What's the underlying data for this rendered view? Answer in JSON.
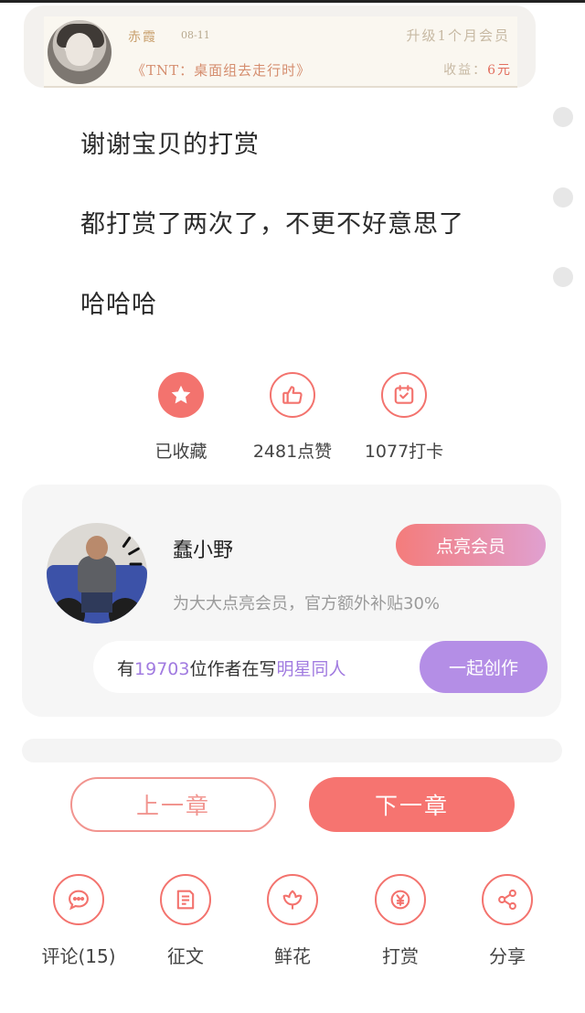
{
  "header": {
    "name": "赤霞",
    "date": "08-11",
    "rank": "升级1个月会员",
    "book": "《TNT：桌面组去走行时》",
    "income_label": "收益：",
    "income_value": "6元"
  },
  "chapter": {
    "lines": [
      "谢谢宝贝的打赏",
      "都打赏了两次了，不更不好意思了",
      "哈哈哈"
    ]
  },
  "actions": [
    {
      "label": "已收藏",
      "icon": "star-icon"
    },
    {
      "label": "2481点赞",
      "icon": "thumbs-up-icon"
    },
    {
      "label": "1077打卡",
      "icon": "checkin-calendar-icon"
    }
  ],
  "author": {
    "name": "蠢小野",
    "member_button": "点亮会员",
    "description": "为大大点亮会员，官方额外补贴30%"
  },
  "write_bar": {
    "prefix": "有",
    "count": "19703",
    "middle": "位作者在写",
    "topic": "明星同人",
    "button": "一起创作"
  },
  "navigation": {
    "prev": "上一章",
    "next": "下一章"
  },
  "toolbar": [
    {
      "label": "评论(15)",
      "icon": "comment-icon"
    },
    {
      "label": "征文",
      "icon": "essay-icon"
    },
    {
      "label": "鲜花",
      "icon": "flower-icon"
    },
    {
      "label": "打赏",
      "icon": "yen-reward-icon"
    },
    {
      "label": "分享",
      "icon": "share-icon"
    }
  ],
  "colors": {
    "accent": "#f3736e",
    "purple": "#b48ee6"
  }
}
